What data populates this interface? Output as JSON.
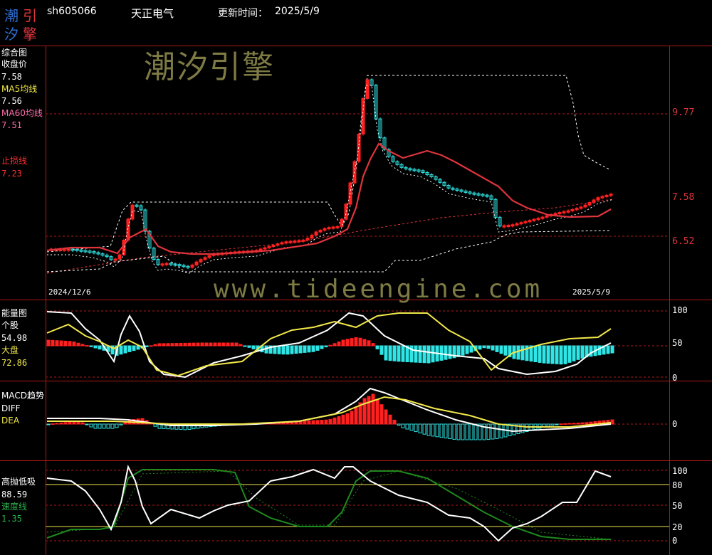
{
  "logo": {
    "chars": [
      "潮",
      "引",
      "汐",
      "擎"
    ]
  },
  "header": {
    "code": "sh605066",
    "name": "天正电气",
    "update_label": "更新时间：",
    "update_date": "2025/5/9"
  },
  "watermark": {
    "cn": "潮汐引擎",
    "url": "www.tideengine.com"
  },
  "panel_main": {
    "title": "综合图",
    "close_label": "收盘价",
    "close_value": "7.58",
    "ma5_label": "MA5均线",
    "ma5_value": "7.56",
    "ma60_label": "MA60均线",
    "ma60_value": "7.51",
    "stop_label": "止损线",
    "stop_value": "7.23",
    "levels": [
      "9.77",
      "7.58",
      "6.52"
    ],
    "date_start": "2024/12/6",
    "date_end": "2025/5/9"
  },
  "panel_energy": {
    "title": "能量图",
    "stock_label": "个股",
    "stock_value": "54.98",
    "market_label": "大盘",
    "market_value": "72.86",
    "ticks": [
      "100",
      "50",
      "0"
    ]
  },
  "panel_macd": {
    "title": "MACD趋势",
    "diff_label": "DIFF",
    "dea_label": "DEA",
    "ticks": [
      "0"
    ]
  },
  "panel_hl": {
    "title": "高抛低吸",
    "value": "88.59",
    "speed_label": "速度线",
    "speed_value": "1.35",
    "ticks": [
      "100",
      "80",
      "50",
      "20",
      "0"
    ]
  },
  "colors": {
    "up": "#ff2020",
    "down": "#2ee6e6",
    "ma": "#e0343c",
    "yellow": "#f2e84a",
    "green": "#1e8a1e",
    "grid": "#b01818"
  }
}
